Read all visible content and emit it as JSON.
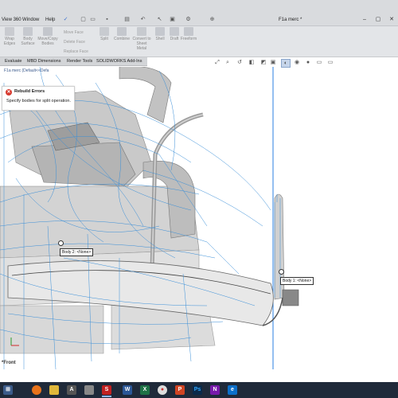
{
  "menubar": {
    "items": [
      "View 360",
      "Window",
      "Help"
    ],
    "pin_icon": "pin-icon"
  },
  "window": {
    "title": "F1a merc *",
    "controls": [
      "search-icon",
      "help-icon",
      "minimize-icon",
      "maximize-icon",
      "close-icon"
    ]
  },
  "ribbon": {
    "buttons": [
      {
        "label": "Wrap Edges",
        "icon": "wrap-icon"
      },
      {
        "label": "Body Surface",
        "icon": "body-icon"
      },
      {
        "label": "Move/Copy Bodies",
        "icon": "move-copy-icon"
      },
      {
        "label": "Split",
        "icon": "split-icon"
      },
      {
        "label": "Combine",
        "icon": "combine-icon"
      },
      {
        "label": "Convert to Sheet Metal",
        "icon": "sheet-metal-icon"
      },
      {
        "label": "Shell",
        "icon": "shell-icon"
      },
      {
        "label": "Draft",
        "icon": "draft-icon"
      },
      {
        "label": "Freeform",
        "icon": "freeform-icon"
      }
    ],
    "small_items": [
      "Move Face",
      "Delete Face",
      "Replace Face"
    ]
  },
  "tabs": [
    "Evaluate",
    "MBD Dimensions",
    "Render Tools",
    "SOLIDWORKS Add-Ins"
  ],
  "tree": {
    "breadcrumb": "F1a merc  (Default<<Defa"
  },
  "error_popup": {
    "title": "Rebuild Errors",
    "message": "Specify bodies for split operation."
  },
  "callouts": [
    {
      "name": "Body 2",
      "value": "<None>"
    },
    {
      "name": "Body 1",
      "value": "<None>"
    }
  ],
  "view": {
    "label": "*Front"
  },
  "colors": {
    "wire": "#3a8fd8",
    "sketch_line": "#2a7fe0",
    "error": "#d73a2f",
    "taskbar": "#1f2a3a"
  },
  "taskbar": {
    "icons": [
      "start-icon",
      "firefox-icon",
      "explorer-icon",
      "autocad-icon",
      "solidworks-icon",
      "app-icon",
      "word-icon",
      "excel-icon",
      "chrome-icon",
      "powerpoint-icon",
      "photoshop-icon",
      "onenote-icon",
      "edge-icon"
    ]
  }
}
